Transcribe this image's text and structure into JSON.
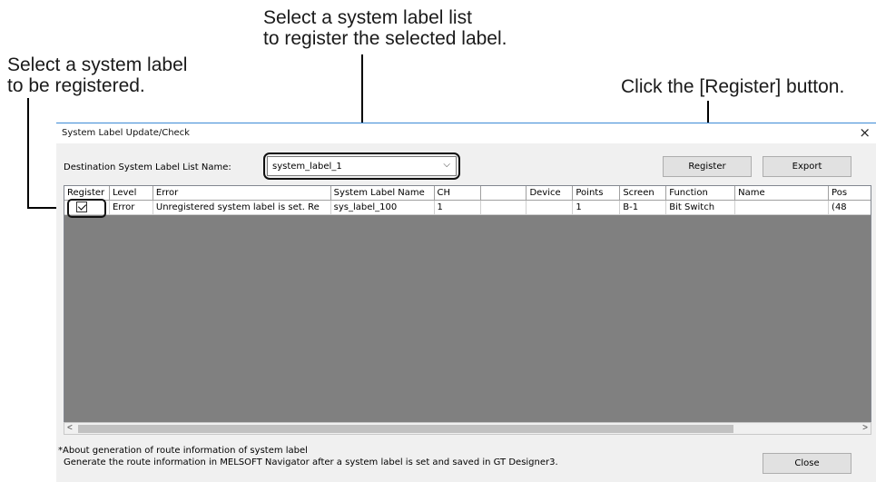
{
  "callouts": {
    "top_line1": "Select a system label list",
    "top_line2": "to register the selected label.",
    "left_line1": "Select a system label",
    "left_line2": "to be registered.",
    "right": "Click the [Register] button."
  },
  "dialog": {
    "title": "System Label Update/Check",
    "close_glyph": "×",
    "destination_label": "Destination System Label List Name:",
    "destination_value": "system_label_1",
    "register_button": "Register",
    "export_button": "Export",
    "close_button": "Close",
    "note_line1": "*About generation of route information of system label",
    "note_line2": "Generate the route information in MELSOFT Navigator after a system label is set and saved in GT Designer3."
  },
  "table": {
    "columns": [
      "Register",
      "Level",
      "Error",
      "System Label Name",
      "CH",
      "",
      "Device",
      "Points",
      "Screen",
      "Function",
      "Name",
      "Pos"
    ],
    "rows": [
      {
        "register_checked": true,
        "level": "Error",
        "error": "Unregistered system label is set. Re",
        "system_label_name": "sys_label_100",
        "ch": "1",
        "blank": "",
        "device": "",
        "points": "1",
        "screen": "B-1",
        "function": "Bit Switch",
        "name": "",
        "pos": "(48"
      }
    ]
  },
  "icons": {
    "dropdown": "chevron-down-icon",
    "scroll_left": "chevron-left-icon",
    "scroll_right": "chevron-right-icon",
    "close": "close-icon"
  },
  "colors": {
    "grid_background": "#808080",
    "title_border": "#3c8ad6",
    "button_face": "#e1e1e1"
  }
}
